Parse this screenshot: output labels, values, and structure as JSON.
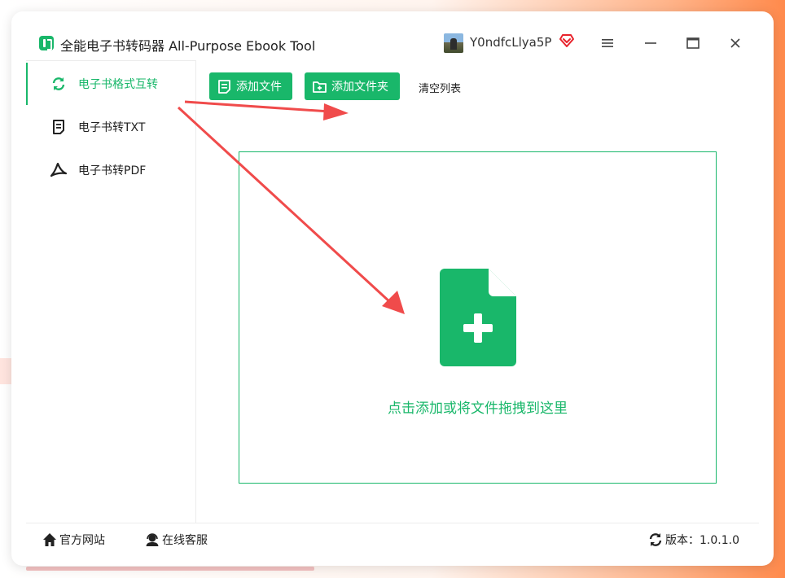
{
  "app": {
    "title": "全能电子书转码器 All-Purpose Ebook Tool",
    "logo_icon": "app-logo-icon",
    "brand_color": "#19b76a"
  },
  "user": {
    "name": "Y0ndfcLlya5P",
    "vip_icon": "diamond-heart-icon",
    "vip_color": "#e8232c"
  },
  "window_controls": [
    "menu-icon",
    "minimize-icon",
    "maximize-icon",
    "close-icon"
  ],
  "sidebar": {
    "items": [
      {
        "label": "电子书格式互转",
        "icon": "refresh-icon",
        "active": true
      },
      {
        "label": "电子书转TXT",
        "icon": "document-icon",
        "active": false
      },
      {
        "label": "电子书转PDF",
        "icon": "pdf-icon",
        "active": false
      }
    ]
  },
  "toolbar": {
    "add_file": "添加文件",
    "add_folder": "添加文件夹",
    "clear_list": "清空列表"
  },
  "dropzone": {
    "text": "点击添加或将文件拖拽到这里",
    "icon": "add-document-icon"
  },
  "annotation_color": "#f04b4b",
  "footer": {
    "website": "官方网站",
    "service": "在线客服",
    "version": "版本：1.0.1.0"
  }
}
